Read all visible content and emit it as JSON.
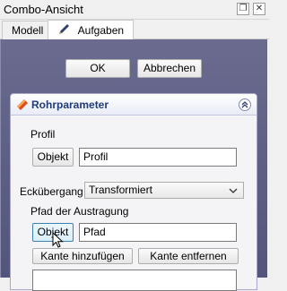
{
  "window": {
    "title": "Combo-Ansicht",
    "float_button": "❐",
    "close_button": "✕"
  },
  "tabs": [
    {
      "label": "Modell"
    },
    {
      "label": "Aufgaben"
    }
  ],
  "dialog": {
    "ok_label": "OK",
    "cancel_label": "Abbrechen"
  },
  "section": {
    "title": "Rohrparameter",
    "profile_label": "Profil",
    "profile_button": "Objekt",
    "profile_value": "Profil",
    "transition_label": "Eckübergang",
    "transition_value": "Transformiert",
    "path_label": "Pfad der Austragung",
    "path_button": "Objekt",
    "path_value": "Pfad",
    "add_edge_button": "Kante hinzufügen",
    "remove_edge_button": "Kante entfernen"
  },
  "colors": {
    "panel": "#5c5d83",
    "section_title": "#1f3b7a"
  }
}
